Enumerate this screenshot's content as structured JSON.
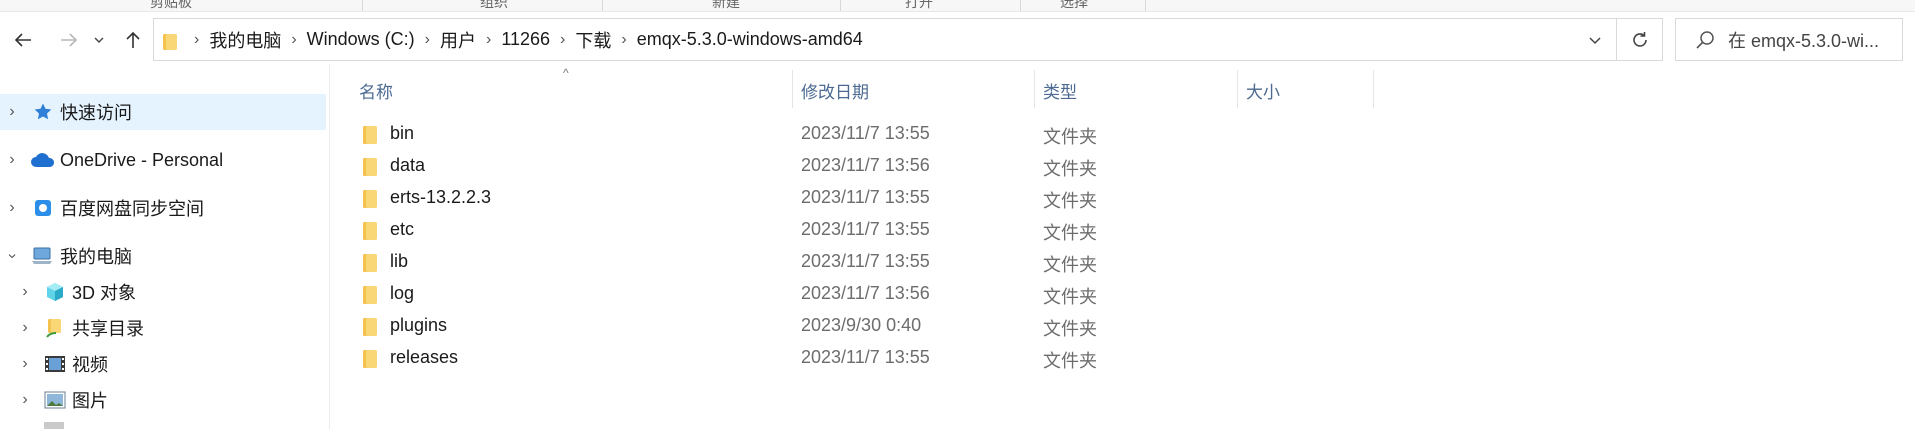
{
  "ribbon": {
    "fragments": [
      "剪贴板",
      "组织",
      "新建",
      "打开",
      "选择"
    ]
  },
  "nav": {
    "back_icon": "arrow-left-icon",
    "forward_icon": "arrow-right-icon",
    "recent_icon": "chevron-down-icon",
    "up_icon": "arrow-up-icon"
  },
  "address": {
    "crumbs": [
      "我的电脑",
      "Windows (C:)",
      "用户",
      "11266",
      "下载",
      "emqx-5.3.0-windows-amd64"
    ],
    "separator": "›"
  },
  "search": {
    "placeholder": "在 emqx-5.3.0-wi..."
  },
  "sidebar": {
    "items": [
      {
        "label": "快速访问",
        "icon": "star-icon",
        "expanded": false
      },
      {
        "label": "OneDrive - Personal",
        "icon": "cloud-icon",
        "expanded": false
      },
      {
        "label": "百度网盘同步空间",
        "icon": "baidu-sync-icon",
        "expanded": false
      },
      {
        "label": "我的电脑",
        "icon": "computer-icon",
        "expanded": true
      },
      {
        "label": "3D 对象",
        "icon": "cube-icon",
        "expanded": false
      },
      {
        "label": "共享目录",
        "icon": "shared-folder-icon",
        "expanded": false
      },
      {
        "label": "视频",
        "icon": "video-icon",
        "expanded": false
      },
      {
        "label": "图片",
        "icon": "picture-icon",
        "expanded": false
      }
    ]
  },
  "columns": {
    "name": "名称",
    "modified": "修改日期",
    "type": "类型",
    "size": "大小"
  },
  "files": [
    {
      "name": "bin",
      "modified": "2023/11/7 13:55",
      "type": "文件夹"
    },
    {
      "name": "data",
      "modified": "2023/11/7 13:56",
      "type": "文件夹"
    },
    {
      "name": "erts-13.2.2.3",
      "modified": "2023/11/7 13:55",
      "type": "文件夹"
    },
    {
      "name": "etc",
      "modified": "2023/11/7 13:55",
      "type": "文件夹"
    },
    {
      "name": "lib",
      "modified": "2023/11/7 13:55",
      "type": "文件夹"
    },
    {
      "name": "log",
      "modified": "2023/11/7 13:56",
      "type": "文件夹"
    },
    {
      "name": "plugins",
      "modified": "2023/9/30 0:40",
      "type": "文件夹"
    },
    {
      "name": "releases",
      "modified": "2023/11/7 13:55",
      "type": "文件夹"
    }
  ],
  "colors": {
    "accent": "#0078d4",
    "selected_bg": "#e5f3ff",
    "folder": "#f4c24d"
  }
}
